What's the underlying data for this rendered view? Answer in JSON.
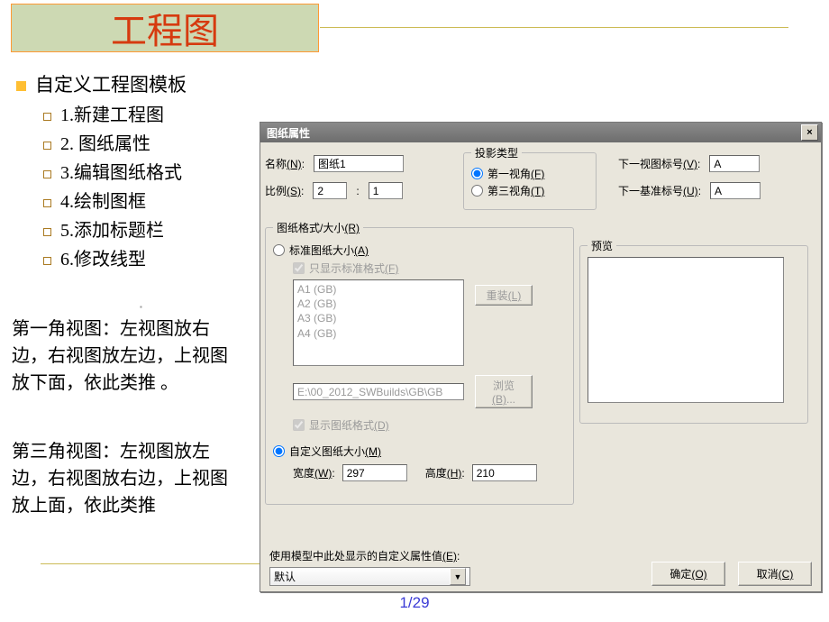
{
  "slide": {
    "title": "工程图",
    "bullet_main": "自定义工程图模板",
    "subs": [
      "1.新建工程图",
      "2. 图纸属性",
      "3.编辑图纸格式",
      "4.绘制图框",
      "5.添加标题栏",
      "6.修改线型"
    ],
    "para1": "第一角视图：左视图放右边，右视图放左边，上视图放下面，依此类推 。",
    "para2": "第三角视图：左视图放左边，右视图放右边，上视图放上面，依此类推",
    "page": "1/29"
  },
  "dialog": {
    "title": "图纸属性",
    "name_label_pre": "名称",
    "name_label_ul": "(N)",
    "name_value": "图纸1",
    "scale_label_pre": "比例",
    "scale_label_ul": "(S)",
    "scale_a": "2",
    "scale_sep": ":",
    "scale_b": "1",
    "proj_legend": "投影类型",
    "proj1_pre": "第一视角",
    "proj1_ul": "(F)",
    "proj3_pre": "第三视角",
    "proj3_ul": "(T)",
    "nextview_label_pre": "下一视图标号",
    "nextview_label_ul": "(V)",
    "nextview_value": "A",
    "nextdatum_label_pre": "下一基准标号",
    "nextdatum_label_ul": "(U)",
    "nextdatum_value": "A",
    "size_legend_pre": "图纸格式/大小",
    "size_legend_ul": "(R)",
    "std_size_pre": "标准图纸大小",
    "std_size_ul": "(A)",
    "only_std_pre": "只显示标准格式",
    "only_std_ul": "(F)",
    "list": [
      "A1 (GB)",
      "A2 (GB)",
      "A3 (GB)",
      "A4 (GB)"
    ],
    "path_value": "E:\\00_2012_SWBuilds\\GB\\GB",
    "show_fmt_pre": "显示图纸格式",
    "show_fmt_ul": "(D)",
    "reload_pre": "重装",
    "reload_ul": "(L)",
    "browse_pre": "浏览",
    "browse_ul": "(B)",
    "browse_suffix": "...",
    "custom_size_pre": "自定义图纸大小",
    "custom_size_ul": "(M)",
    "width_label_pre": "宽度",
    "width_label_ul": "(W)",
    "width_value": "297",
    "height_label_pre": "高度",
    "height_label_ul": "(H)",
    "height_value": "210",
    "preview_legend": "预览",
    "model_prop_label_pre": "使用模型中此处显示的自定义属性值",
    "model_prop_label_ul": "(E)",
    "model_prop_value": "默认",
    "ok_pre": "确定",
    "ok_ul": "(O)",
    "cancel_pre": "取消",
    "cancel_ul": "(C)"
  }
}
